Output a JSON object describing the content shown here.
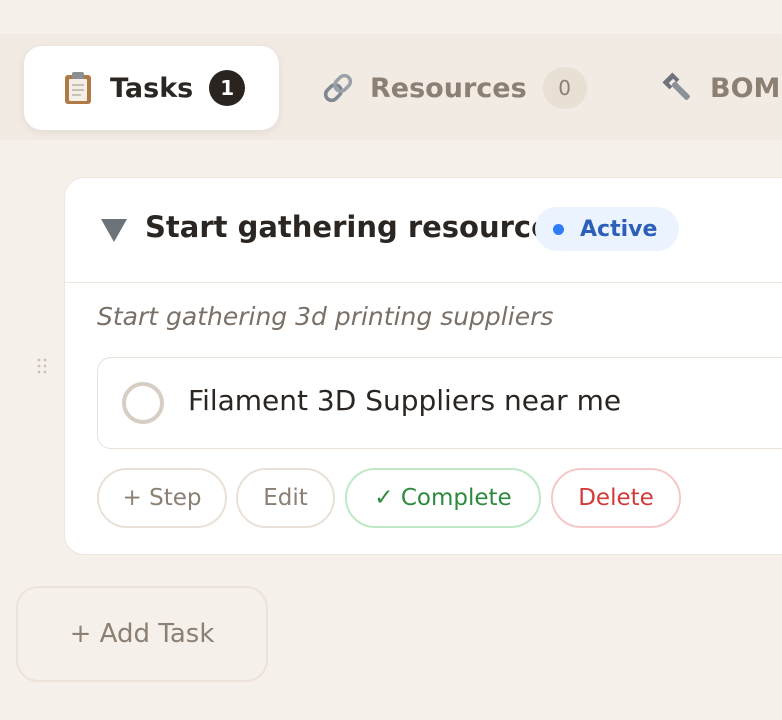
{
  "tabs": [
    {
      "label": "Tasks",
      "count": "1",
      "icon": "clipboard-icon",
      "active": true
    },
    {
      "label": "Resources",
      "count": "0",
      "icon": "link-icon",
      "active": false
    },
    {
      "label": "BOM",
      "icon": "wrench-icon",
      "active": false
    }
  ],
  "task": {
    "title": "Start gathering resources",
    "status": "Active",
    "description": "Start gathering 3d printing suppliers",
    "steps": [
      {
        "label": "Filament 3D Suppliers near me",
        "done": false
      }
    ],
    "actions": {
      "add_step": "+ Step",
      "edit": "Edit",
      "complete": "✓ Complete",
      "delete": "Delete"
    }
  },
  "add_task_label": "+ Add Task",
  "colors": {
    "background": "#f6f0ea",
    "active_blue": "#2f7cf6",
    "complete_green": "#2e8a3e",
    "delete_red": "#d23b3b"
  }
}
